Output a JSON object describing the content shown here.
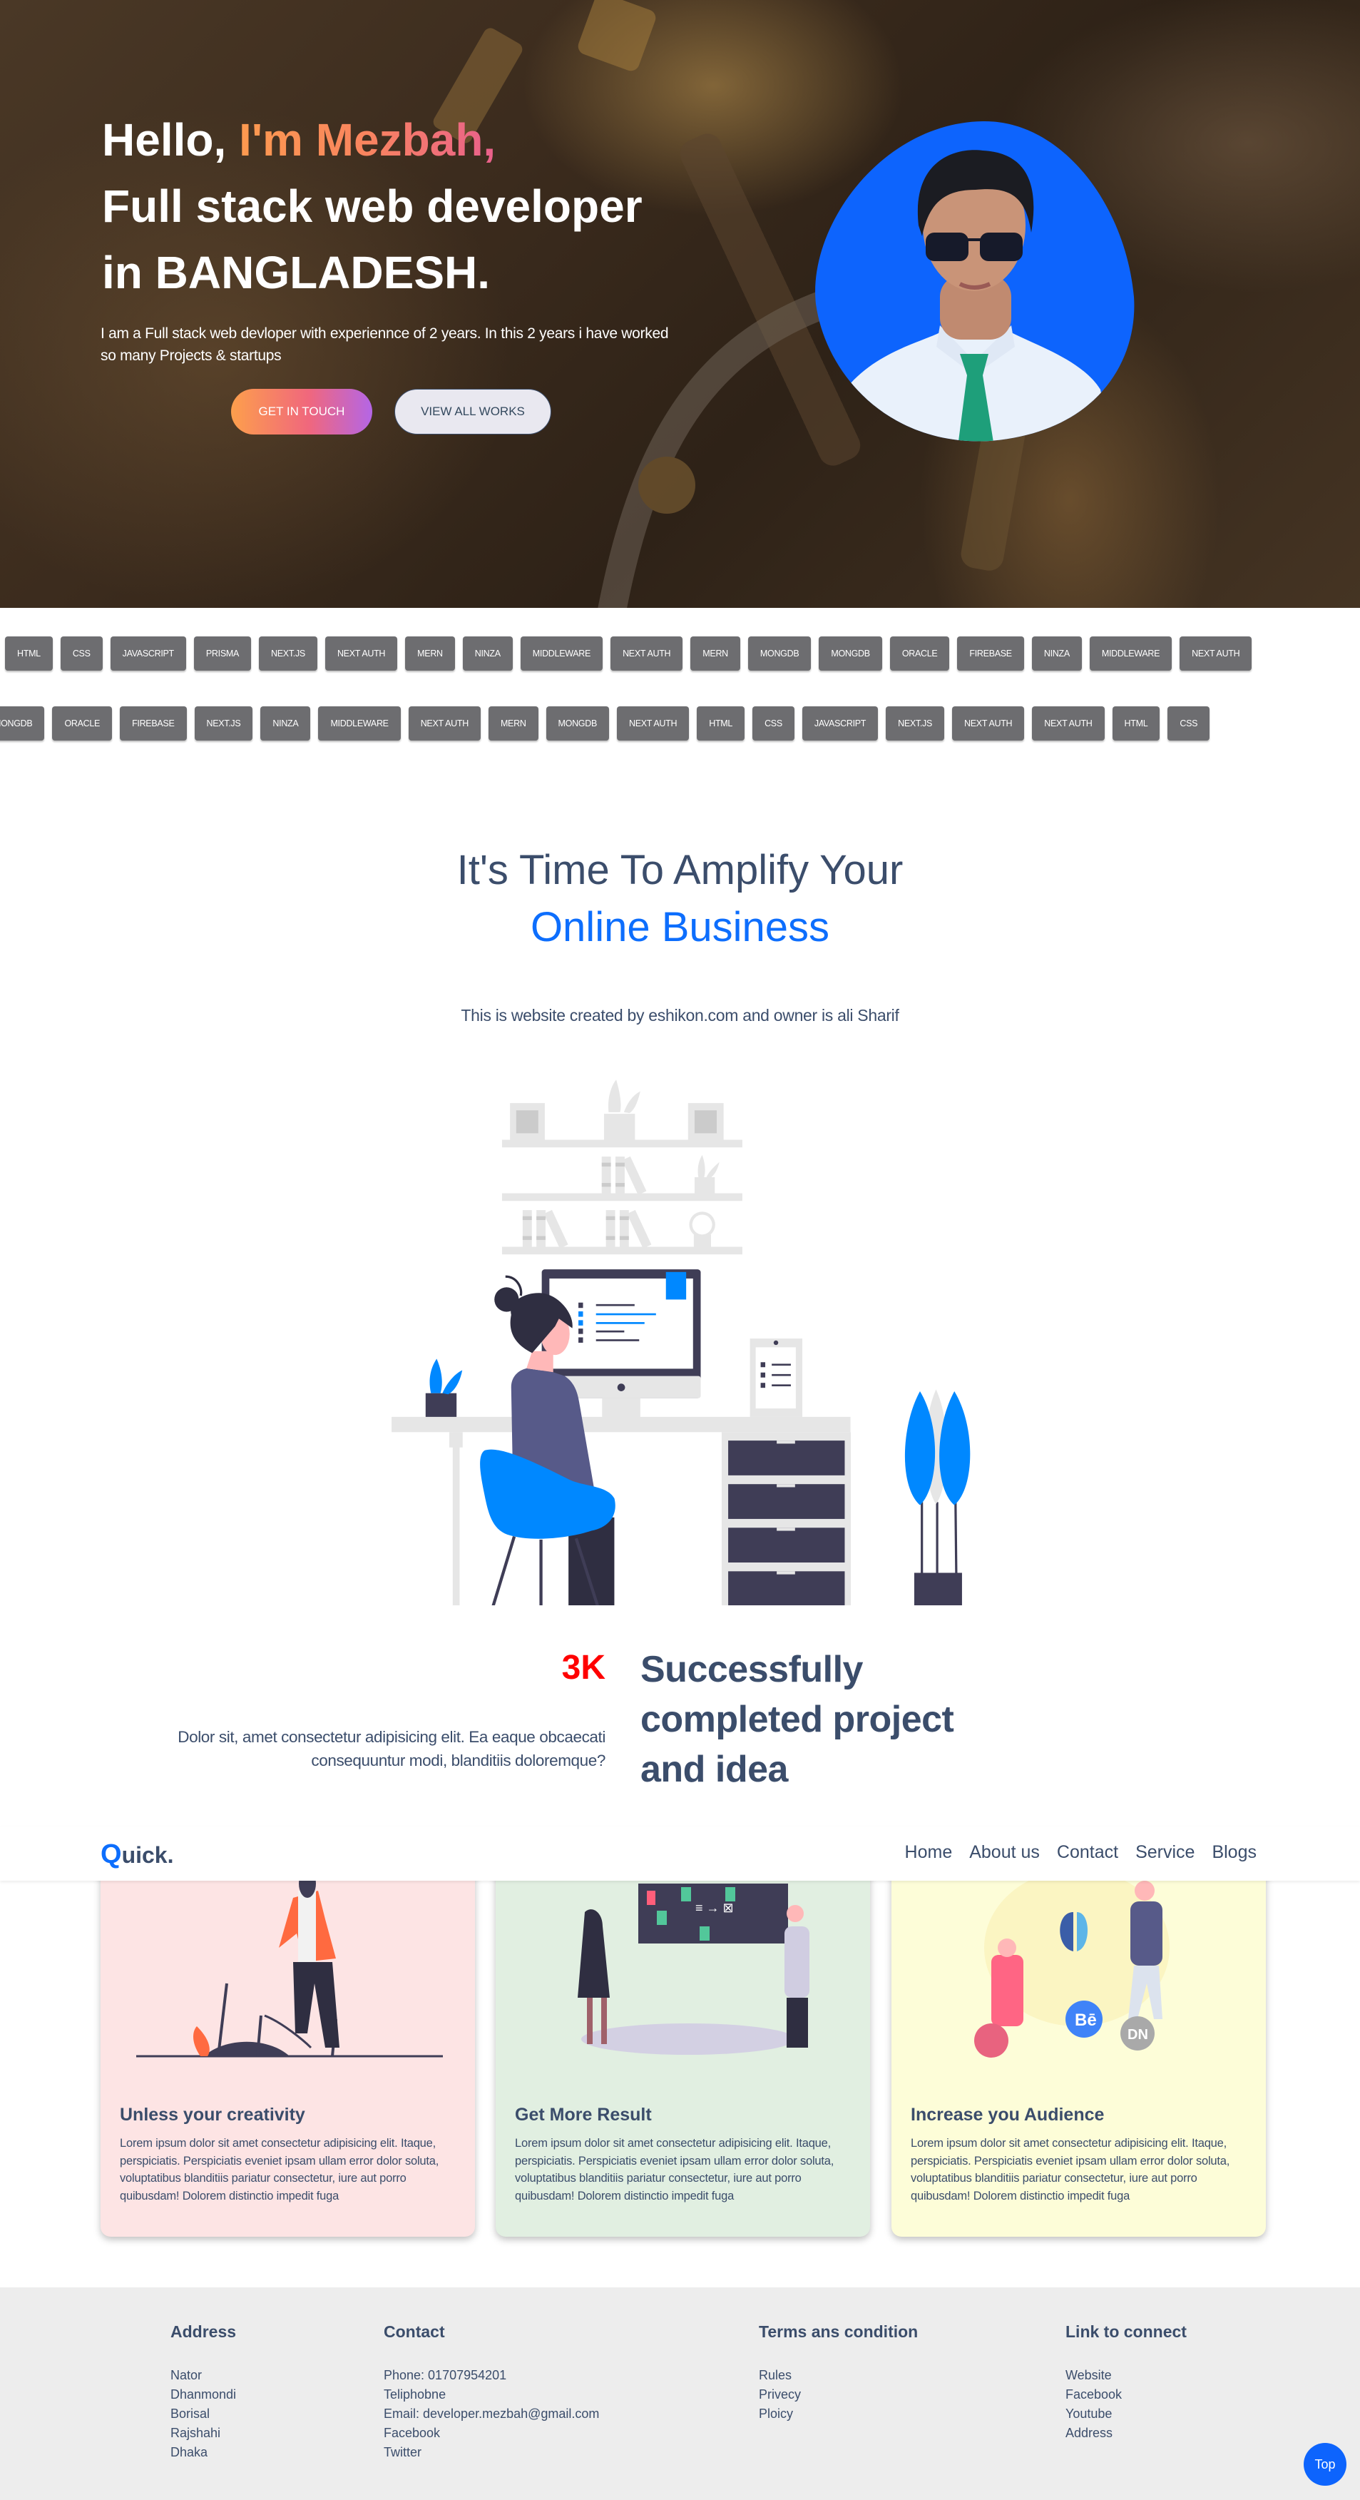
{
  "hero": {
    "greeting": "Hello, ",
    "name": "I'm Mezbah,",
    "line2": "Full stack web developer",
    "line3": "in BANGLADESH.",
    "description": "I am a Full stack web devloper with experiennce of 2 years. In this 2 years i have worked so many Projects & startups",
    "primary_button": "GET IN TOUCH",
    "secondary_button": "VIEW ALL WORKS"
  },
  "skills": {
    "row1": [
      "HTML",
      "CSS",
      "JAVASCRIPT",
      "PRISMA",
      "NEXT.JS",
      "NEXT AUTH",
      "MERN",
      "NINZA",
      "MIDDLEWARE",
      "NEXT AUTH",
      "MERN",
      "MONGDB",
      "MONGDB",
      "ORACLE",
      "FIREBASE",
      "NINZA",
      "MIDDLEWARE",
      "NEXT AUTH"
    ],
    "row2": [
      "MONGDB",
      "ORACLE",
      "FIREBASE",
      "NEXT.JS",
      "NINZA",
      "MIDDLEWARE",
      "NEXT AUTH",
      "MERN",
      "MONGDB",
      "NEXT AUTH",
      "HTML",
      "CSS",
      "JAVASCRIPT",
      "NEXT.JS",
      "NEXT AUTH",
      "NEXT AUTH",
      "HTML",
      "CSS"
    ]
  },
  "amplify": {
    "title_line1": "It's Time To Amplify Your",
    "title_line2": "Online Business",
    "subtitle": "This is website created by eshikon.com and owner is ali Sharif"
  },
  "stats": {
    "count": "3K",
    "headline_lines": [
      "Successfully",
      "completed project",
      "and idea"
    ],
    "description": "Dolor sit, amet consectetur adipisicing elit. Ea eaque obcaecati consequuntur modi, blanditiis doloremque?"
  },
  "navbar": {
    "logo_initial": "Q",
    "logo_rest": "uick.",
    "links": [
      "Home",
      "About us",
      "Contact",
      "Service",
      "Blogs"
    ]
  },
  "cards": [
    {
      "title": "Unless your creativity",
      "text": "Lorem ipsum dolor sit amet consectetur adipisicing elit. Itaque, perspiciatis. Perspiciatis eveniet ipsam ullam error dolor soluta, voluptatibus blanditiis pariatur consectetur, iure aut porro quibusdam! Dolorem distinctio impedit fuga",
      "bg": "#fde4e4"
    },
    {
      "title": "Get More Result",
      "text": "Lorem ipsum dolor sit amet consectetur adipisicing elit. Itaque, perspiciatis. Perspiciatis eveniet ipsam ullam error dolor soluta, voluptatibus blanditiis pariatur consectetur, iure aut porro quibusdam! Dolorem distinctio impedit fuga",
      "bg": "#e1efe1"
    },
    {
      "title": "Increase you Audience",
      "text": "Lorem ipsum dolor sit amet consectetur adipisicing elit. Itaque, perspiciatis. Perspiciatis eveniet ipsam ullam error dolor soluta, voluptatibus blanditiis pariatur consectetur, iure aut porro quibusdam! Dolorem distinctio impedit fuga",
      "bg": "#fdfdd8"
    }
  ],
  "footer": {
    "address": {
      "title": "Address",
      "items": [
        "Nator",
        "Dhanmondi",
        "Borisal",
        "Rajshahi",
        "Dhaka"
      ]
    },
    "contact": {
      "title": "Contact",
      "items": [
        "Phone: 01707954201",
        "Teliphobne",
        "Email: developer.mezbah@gmail.com",
        "Facebook",
        "Twitter"
      ]
    },
    "terms": {
      "title": "Terms ans condition",
      "items": [
        "Rules",
        "Privecy",
        "Ploicy"
      ]
    },
    "links": {
      "title": "Link to connect",
      "items": [
        "Website",
        "Facebook",
        "Youtube",
        "Address"
      ]
    }
  },
  "top_button": "Top",
  "colors": {
    "accent": "#0d6efd",
    "text": "#3b4d6b",
    "stat": "#ff0000",
    "tag": "#6d6d70",
    "footer_bg": "#ededed"
  }
}
